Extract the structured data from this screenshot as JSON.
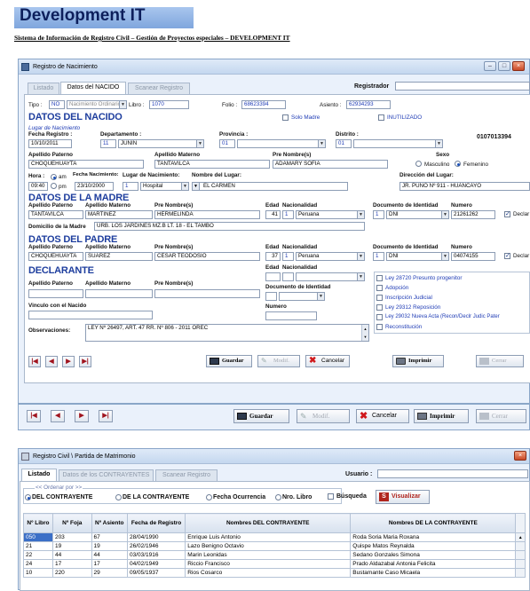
{
  "header": {
    "title": "Development IT",
    "subtitle": "Sistema de Información de Registro Civil – Gestión de Proyectos especiales – DEVELOPMENT IT"
  },
  "w1": {
    "title": "Registro de Nacimiento",
    "tabs": [
      "Listado",
      "Datos del NACIDO",
      "Scanear Registro"
    ],
    "registrador_label": "Registrador",
    "tipo_label": "Tipo :",
    "tipo_code": "NO",
    "tipo_value": "Nacimiento Ordinario",
    "libro_label": "Libro :",
    "libro_value": "1070",
    "folio_label": "Folio :",
    "folio_value": "68623394",
    "asiento_label": "Asiento :",
    "asiento_value": "62934293",
    "sec_nacido": "DATOS DEL NACIDO",
    "solo_madre": "Solo Madre",
    "inutilizado": "INUTILIZADO",
    "lugar_nac": "Lugar de Nacimiento",
    "record_id": "0107013394",
    "fecha_reg_label": "Fecha Registro :",
    "fecha_reg": "10/10/2011",
    "depto_label": "Departamento :",
    "depto_code": "11",
    "depto_value": "JUNIN",
    "prov_label": "Provincia :",
    "prov_code": "01",
    "dist_label": "Distrito :",
    "dist_code": "01",
    "ap_pat_label": "Apellido Paterno",
    "ap_pat": "CHOQUEHUAYTA",
    "ap_mat_label": "Apellido Materno",
    "ap_mat": "TANTAVILCA",
    "nombres_label": "Pre Nombre(s)",
    "nombres": "ADAMARY SOFIA",
    "sexo_label": "Sexo",
    "sexo_m": "Masculino",
    "sexo_f": "Femenino",
    "hora_label": "Hora :",
    "hora": "09:40",
    "am": "am",
    "pm": "pm",
    "fnac_label": "Fecha Nacimiento:",
    "fnac": "23/10/2000",
    "lugar_label": "Lugar de Nacimiento:",
    "lugar_code": "1",
    "lugar_value": "Hospital",
    "nombre_lugar_label": "Nombre del Lugar:",
    "nombre_lugar": "EL CARMEN",
    "direccion_label": "Dirección del Lugar:",
    "direccion": "JR. PUNO Nº 911 - HUANCAYO",
    "sec_madre": "DATOS DE LA MADRE",
    "m_ap_pat": "TANTAVILCA",
    "m_ap_mat": "MARTINEZ",
    "m_nombres": "HERMELINDA",
    "edad_label": "Edad",
    "nac_label": "Nacionalidad",
    "m_edad": "41",
    "m_nac_code": "1",
    "m_nac": "Peruana",
    "doc_label": "Documento de Identidad",
    "numero_label": "Numero",
    "m_doc_code": "1",
    "m_doc": "DNI",
    "m_num": "21261262",
    "declar": "Declar",
    "domicilio_label": "Domicilio de la Madre",
    "domicilio": "URB. LOS JARDINES MZ.B LT. 18 - EL TAMBO",
    "sec_padre": "DATOS DEL PADRE",
    "p_ap_pat": "CHOQUEHUAYTA",
    "p_ap_mat": "SUAREZ",
    "p_nombres": "CESAR TEODOSIO",
    "p_edad": "37",
    "p_nac_code": "1",
    "p_nac": "Peruana",
    "p_doc_code": "1",
    "p_doc": "DNI",
    "p_num": "04074155",
    "sec_declarante": "DECLARANTE",
    "doc_ident_label": "Documento de Identidad",
    "vinculo_label": "Vinculo con el Nacido",
    "checks": [
      "Ley 28720 Presunto progenitor",
      "Adopción",
      "Inscripción Judicial",
      "Ley 29312 Reposición",
      "Ley 29032 Nueva Acta (Recon/Declr Judic Pater",
      "Reconstitución"
    ],
    "obs_label": "Observaciones:",
    "obs": "LEY Nº 26497, ART. 47  RR. Nº 806 - 2011 OREC",
    "btn_guardar": "Guardar",
    "btn_modif": "Modif.",
    "btn_cancelar": "Cancelar",
    "btn_imprimir": "Imprimir",
    "btn_cerrar": "Cerrar"
  },
  "bar2": {
    "btn_guardar": "Guardar",
    "btn_modif": "Modif.",
    "btn_cancelar": "Cancelar",
    "btn_imprimir": "Imprimir",
    "btn_cerrar": "Cerrar"
  },
  "w2": {
    "title": "Registro Civil \\ Partida de Matrimonio",
    "tabs": [
      "Listado",
      "Datos de los CONTRAYENTES",
      "Scanear Registro"
    ],
    "usuario_label": "Usuario :",
    "ordenar_label": "<< Ordenar por >>",
    "opts": [
      "DEL CONTRAYENTE",
      "DE LA CONTRAYENTE",
      "Fecha Ocurrencia",
      "Nro. Libro"
    ],
    "busqueda": "Búsqueda",
    "visualizar": "Visualizar",
    "headers": [
      "Nº Libro",
      "Nº Foja",
      "Nº Asiento",
      "Fecha de Registro",
      "Nombres DEL CONTRAYENTE",
      "Nombres DE LA CONTRAYENTE"
    ],
    "rows": [
      [
        "050",
        "203",
        "67",
        "28/04/1990",
        "Enrique Luis Antonio",
        "Roda Soria Maria Roxana"
      ],
      [
        "21",
        "19",
        "19",
        "26/02/1946",
        "Lazo Benigno Octavio",
        "Quispe Matos Reynalda"
      ],
      [
        "22",
        "44",
        "44",
        "03/03/1916",
        "Marin Leonidas",
        "Sedano Gonzales Simona"
      ],
      [
        "24",
        "17",
        "17",
        "04/02/1949",
        "Riccio Francisco",
        "Prado Aldazabal Antonia Felicita"
      ],
      [
        "10",
        "220",
        "29",
        "09/05/1937",
        "Rios Cosarco",
        "Bustamante Caso Micaela"
      ]
    ]
  }
}
